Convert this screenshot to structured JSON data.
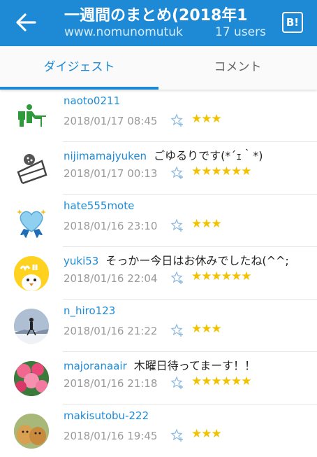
{
  "appbar": {
    "title": "一週間のまとめ(2018年1",
    "url": "www.nomunomutuk",
    "users": "17 users",
    "b_icon": "B!"
  },
  "tabs": [
    {
      "label": "ダイジェスト"
    },
    {
      "label": "コメント"
    }
  ],
  "accent_color": "#1e8ad6",
  "comments": [
    {
      "user": "naoto0211",
      "comment": "",
      "date": "2018/01/17 08:45",
      "stars": "★★★",
      "star_count": 3
    },
    {
      "user": "nijimamajyuken",
      "comment": "ごゆるりです(*´ｪ｀*)",
      "date": "2018/01/17 00:13",
      "stars": "★★★★★★",
      "star_count": 6
    },
    {
      "user": "hate555mote",
      "comment": "",
      "date": "2018/01/16 23:10",
      "stars": "★★★",
      "star_count": 3
    },
    {
      "user": "yuki53",
      "comment": "そっかー今日はお休みでしたね(^^;",
      "date": "2018/01/16 22:04",
      "stars": "★★★★★★",
      "star_count": 6
    },
    {
      "user": "n_hiro123",
      "comment": "",
      "date": "2018/01/16 21:22",
      "stars": "★★★",
      "star_count": 3
    },
    {
      "user": "majoranaair",
      "comment": "木曜日待ってまーす！！",
      "date": "2018/01/16 21:18",
      "stars": "★★★★★★",
      "star_count": 6
    },
    {
      "user": "makisutobu-222",
      "comment": "",
      "date": "2018/01/16 19:45",
      "stars": "★★★",
      "star_count": 3
    }
  ]
}
